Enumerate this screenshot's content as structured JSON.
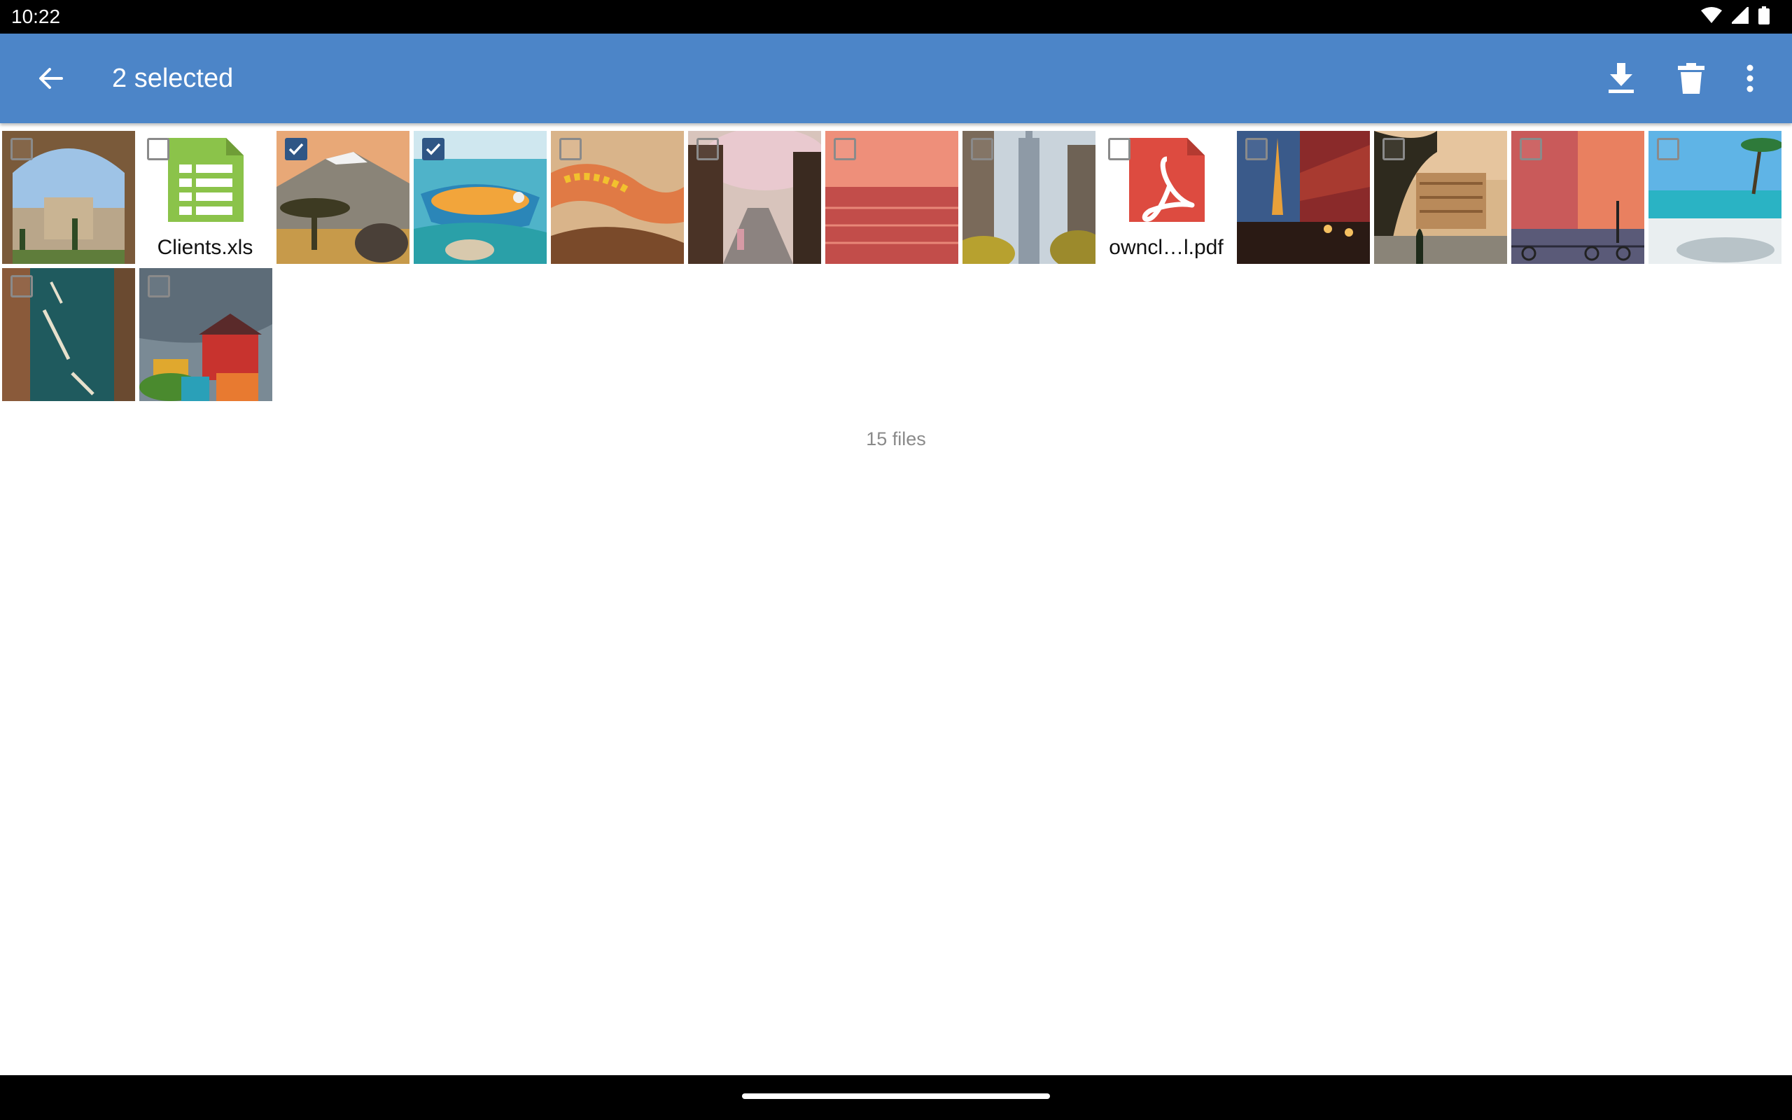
{
  "status_bar": {
    "time": "10:22",
    "icons": [
      "wifi-icon",
      "signal-icon",
      "battery-icon"
    ]
  },
  "app_bar": {
    "title": "2 selected",
    "color": "#4C85C8",
    "actions": [
      "back-arrow-icon",
      "download-icon",
      "delete-icon",
      "more-vert-icon"
    ]
  },
  "files": [
    {
      "name": "alhambra-photo",
      "type": "image",
      "checked": false
    },
    {
      "name": "Clients.xls",
      "type": "spreadsheet",
      "checked": false,
      "label": "Clients.xls"
    },
    {
      "name": "kilimanjaro-photo",
      "type": "image",
      "checked": true
    },
    {
      "name": "boats-photo",
      "type": "image",
      "checked": true
    },
    {
      "name": "gecko-photo",
      "type": "image",
      "checked": false
    },
    {
      "name": "kyoto-street-photo",
      "type": "image",
      "checked": false
    },
    {
      "name": "sunset-sea-photo",
      "type": "image",
      "checked": false
    },
    {
      "name": "skyscraper-photo",
      "type": "image",
      "checked": false
    },
    {
      "name": "ownCloud manual.pdf",
      "type": "pdf",
      "checked": false,
      "label": "owncl…l.pdf"
    },
    {
      "name": "eiffel-tower-photo",
      "type": "image",
      "checked": false
    },
    {
      "name": "colosseum-photo",
      "type": "image",
      "checked": false
    },
    {
      "name": "cyclists-photo",
      "type": "image",
      "checked": false
    },
    {
      "name": "beach-photo",
      "type": "image",
      "checked": false
    },
    {
      "name": "canal-boats-photo",
      "type": "image",
      "checked": false
    },
    {
      "name": "colorful-houses-photo",
      "type": "image",
      "checked": false
    }
  ],
  "footer": {
    "count_text": "15 files"
  }
}
